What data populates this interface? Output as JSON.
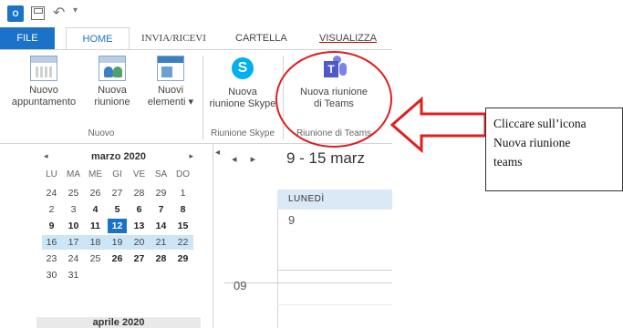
{
  "quick_access": {
    "app_icon": "outlook-icon",
    "app_icon_text": "O",
    "save_icon": "save-icon",
    "undo_icon": "undo-icon",
    "customize_icon": "dropdown-icon"
  },
  "tabs": {
    "file": "FILE",
    "home": "HOME",
    "send_receive": "INVIA/RICEVI",
    "folder": "CARTELLA",
    "view": "VISUALIZZA"
  },
  "ribbon": {
    "new_appointment": {
      "line1": "Nuovo",
      "line2": "appuntamento"
    },
    "new_meeting": {
      "line1": "Nuova",
      "line2": "riunione"
    },
    "new_items": {
      "line1": "Nuovi",
      "line2": "elementi ▾"
    },
    "group_new": "Nuovo",
    "skype_meeting": {
      "line1": "Nuova",
      "line2": "riunione Skype"
    },
    "group_skype": "Riunione Skype",
    "teams_meeting": {
      "line1": "Nuova riunione",
      "line2": "di Teams"
    },
    "group_teams": "Riunione di Teams",
    "colors": {
      "accent": "#1a73c9",
      "teams": "#5059c9",
      "skype": "#00aff0",
      "highlight": "#e01e1e"
    }
  },
  "mini_calendar": {
    "month_label": "marzo 2020",
    "next_month_label": "aprile 2020",
    "prev": "◂",
    "next": "▸",
    "weekdays": [
      "LU",
      "MA",
      "ME",
      "GI",
      "VE",
      "SA",
      "DO"
    ],
    "weeks": [
      [
        "24",
        "25",
        "26",
        "27",
        "28",
        "29",
        "1"
      ],
      [
        "2",
        "3",
        "4",
        "5",
        "6",
        "7",
        "8"
      ],
      [
        "9",
        "10",
        "11",
        "12",
        "13",
        "14",
        "15"
      ],
      [
        "16",
        "17",
        "18",
        "19",
        "20",
        "21",
        "22"
      ],
      [
        "23",
        "24",
        "25",
        "26",
        "27",
        "28",
        "29"
      ],
      [
        "30",
        "31",
        "",
        "",
        "",
        "",
        ""
      ]
    ],
    "today": "12"
  },
  "main_calendar": {
    "nav_prev": "◂",
    "nav_next": "▸",
    "date_range": "9 - 15 marz",
    "day_header": "LUNEDÌ",
    "day_number": "9",
    "hour_label": "09"
  },
  "callout": {
    "line1": "Cliccare sull’icona",
    "line2": "Nuova riunione",
    "line3": "teams"
  }
}
